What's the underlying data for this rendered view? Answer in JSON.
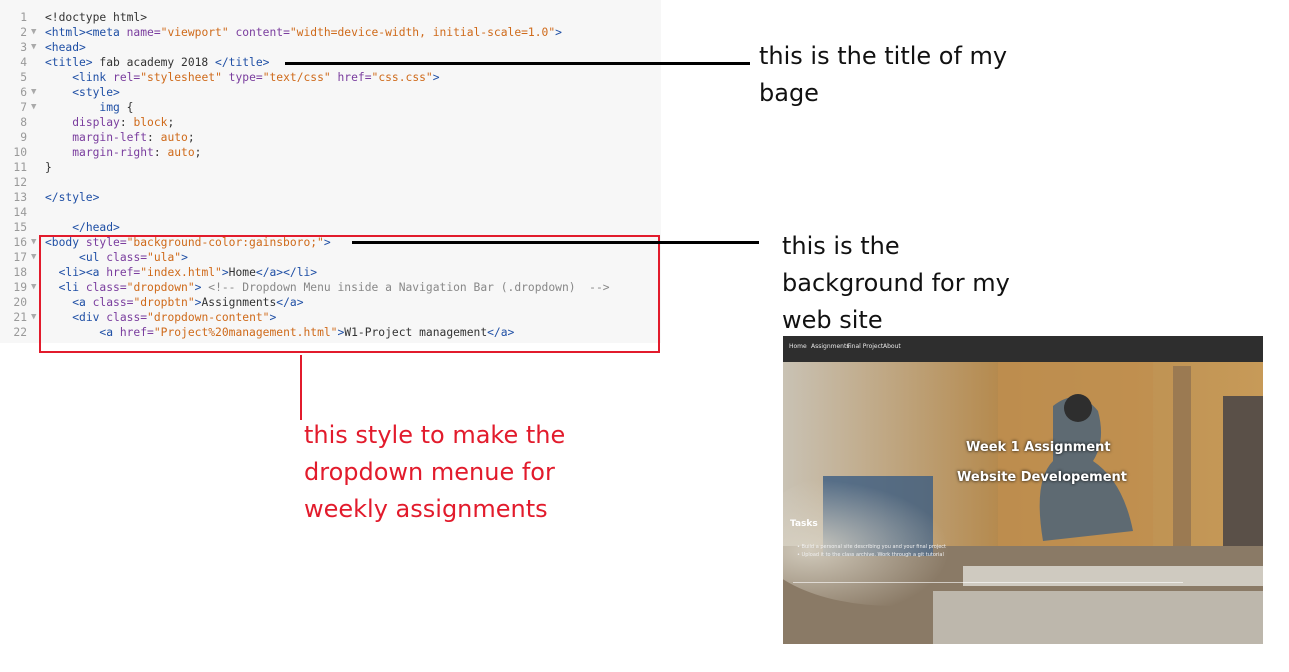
{
  "editor": {
    "lines": [
      {
        "n": "1",
        "fold": "",
        "parts": [
          [
            "p",
            "<!doctype html>"
          ]
        ]
      },
      {
        "n": "2",
        "fold": "▼",
        "parts": [
          [
            "t",
            "<html><meta "
          ],
          [
            "a",
            "name="
          ],
          [
            "s",
            "\"viewport\""
          ],
          [
            "a",
            " content="
          ],
          [
            "s",
            "\"width=device-width, initial-scale=1.0\""
          ],
          [
            "t",
            ">"
          ]
        ]
      },
      {
        "n": "3",
        "fold": "▼",
        "parts": [
          [
            "t",
            "<head>"
          ]
        ]
      },
      {
        "n": "4",
        "fold": "",
        "parts": [
          [
            "t",
            "<title>"
          ],
          [
            "p",
            " fab academy 2018 "
          ],
          [
            "t",
            "</title>"
          ]
        ]
      },
      {
        "n": "5",
        "fold": "",
        "parts": [
          [
            "p",
            "    "
          ],
          [
            "t",
            "<link "
          ],
          [
            "a",
            "rel="
          ],
          [
            "s",
            "\"stylesheet\""
          ],
          [
            "a",
            " type="
          ],
          [
            "s",
            "\"text/css\""
          ],
          [
            "a",
            " href="
          ],
          [
            "s",
            "\"css.css\""
          ],
          [
            "t",
            ">"
          ]
        ]
      },
      {
        "n": "6",
        "fold": "▼",
        "parts": [
          [
            "p",
            "    "
          ],
          [
            "t",
            "<style>"
          ]
        ]
      },
      {
        "n": "7",
        "fold": "▼",
        "parts": [
          [
            "p",
            "        "
          ],
          [
            "t",
            "img"
          ],
          [
            "p",
            " {"
          ]
        ]
      },
      {
        "n": "8",
        "fold": "",
        "parts": [
          [
            "p",
            "    "
          ],
          [
            "a",
            "display"
          ],
          [
            "p",
            ": "
          ],
          [
            "s",
            "block"
          ],
          [
            "p",
            ";"
          ]
        ]
      },
      {
        "n": "9",
        "fold": "",
        "parts": [
          [
            "p",
            "    "
          ],
          [
            "a",
            "margin-left"
          ],
          [
            "p",
            ": "
          ],
          [
            "s",
            "auto"
          ],
          [
            "p",
            ";"
          ]
        ]
      },
      {
        "n": "10",
        "fold": "",
        "parts": [
          [
            "p",
            "    "
          ],
          [
            "a",
            "margin-right"
          ],
          [
            "p",
            ": "
          ],
          [
            "s",
            "auto"
          ],
          [
            "p",
            ";"
          ]
        ]
      },
      {
        "n": "11",
        "fold": "",
        "parts": [
          [
            "p",
            "}"
          ]
        ]
      },
      {
        "n": "12",
        "fold": "",
        "parts": [
          [
            "p",
            ""
          ]
        ]
      },
      {
        "n": "13",
        "fold": "",
        "parts": [
          [
            "t",
            "</style>"
          ]
        ]
      },
      {
        "n": "14",
        "fold": "",
        "parts": [
          [
            "p",
            ""
          ]
        ]
      },
      {
        "n": "15",
        "fold": "",
        "parts": [
          [
            "p",
            "    "
          ],
          [
            "t",
            "</head>"
          ]
        ]
      },
      {
        "n": "16",
        "fold": "▼",
        "parts": [
          [
            "t",
            "<body "
          ],
          [
            "a",
            "style="
          ],
          [
            "s",
            "\"background-color:gainsboro;\""
          ],
          [
            "t",
            ">"
          ]
        ]
      },
      {
        "n": "17",
        "fold": "▼",
        "parts": [
          [
            "p",
            "     "
          ],
          [
            "t",
            "<ul "
          ],
          [
            "a",
            "class="
          ],
          [
            "s",
            "\"ula\""
          ],
          [
            "t",
            ">"
          ]
        ]
      },
      {
        "n": "18",
        "fold": "",
        "parts": [
          [
            "p",
            "  "
          ],
          [
            "t",
            "<li><a "
          ],
          [
            "a",
            "href="
          ],
          [
            "s",
            "\"index.html\""
          ],
          [
            "t",
            ">"
          ],
          [
            "p",
            "Home"
          ],
          [
            "t",
            "</a></li>"
          ]
        ]
      },
      {
        "n": "19",
        "fold": "▼",
        "parts": [
          [
            "p",
            "  "
          ],
          [
            "t",
            "<li "
          ],
          [
            "a",
            "class="
          ],
          [
            "s",
            "\"dropdown\""
          ],
          [
            "t",
            ">"
          ],
          [
            "c",
            " <!-- Dropdown Menu inside a Navigation Bar (.dropdown)  -->"
          ]
        ]
      },
      {
        "n": "20",
        "fold": "",
        "parts": [
          [
            "p",
            "    "
          ],
          [
            "t",
            "<a "
          ],
          [
            "a",
            "class="
          ],
          [
            "s",
            "\"dropbtn\""
          ],
          [
            "t",
            ">"
          ],
          [
            "p",
            "Assignments"
          ],
          [
            "t",
            "</a>"
          ]
        ]
      },
      {
        "n": "21",
        "fold": "▼",
        "parts": [
          [
            "p",
            "    "
          ],
          [
            "t",
            "<div "
          ],
          [
            "a",
            "class="
          ],
          [
            "s",
            "\"dropdown-content\""
          ],
          [
            "t",
            ">"
          ]
        ]
      },
      {
        "n": "22",
        "fold": "",
        "parts": [
          [
            "p",
            "        "
          ],
          [
            "t",
            "<a "
          ],
          [
            "a",
            "href="
          ],
          [
            "s",
            "\"Project%20management.html\""
          ],
          [
            "t",
            ">"
          ],
          [
            "p",
            "W1-Project management"
          ],
          [
            "t",
            "</a>"
          ]
        ]
      }
    ]
  },
  "annotations": {
    "title_note": [
      "this is the title of my",
      "bage"
    ],
    "background_note": [
      "this is the",
      "background for my",
      "web site"
    ],
    "dropdown_note": [
      "this style to make the",
      "dropdown menue for",
      "weekly assignments"
    ]
  },
  "preview": {
    "nav": [
      "Home",
      "Assignments",
      "Final Project",
      "About"
    ],
    "heading1": "Week 1 Assignment",
    "heading2": "Website Developement",
    "tasks_label": "Tasks",
    "task_items": [
      "Build a personal site describing you and your final project",
      "Upload it to the class archive. Work through a git tutorial"
    ]
  },
  "colors": {
    "annotation_red": "#e21b2c",
    "editor_bg": "#f7f7f7",
    "tag": "#1f4fa5",
    "attr": "#7a3d9e",
    "string": "#cf6a1a"
  }
}
